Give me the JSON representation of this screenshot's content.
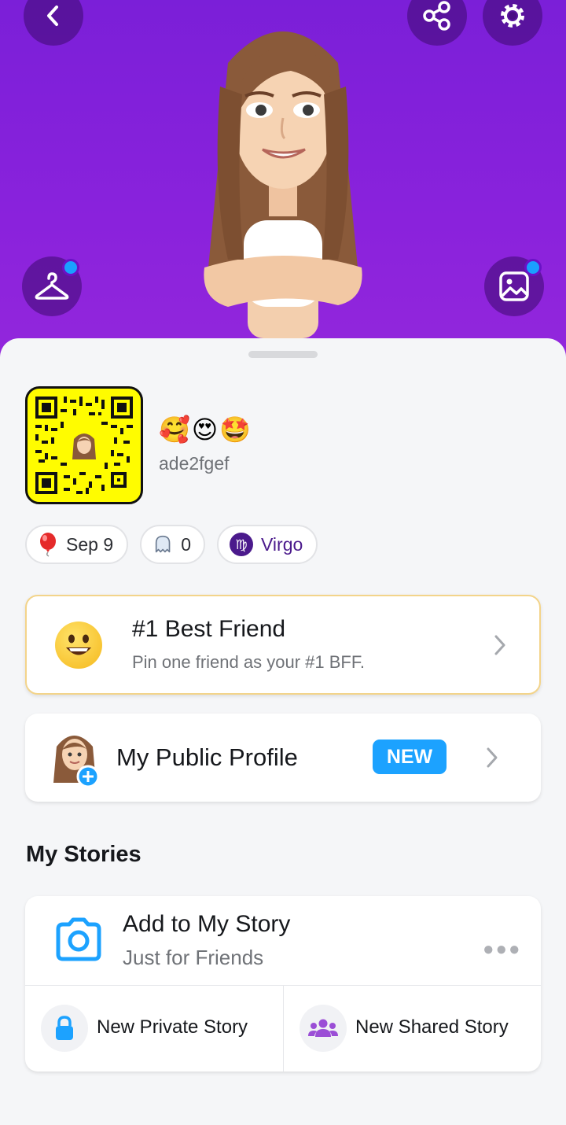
{
  "header": {
    "back_icon": "chevron-left-icon",
    "share_icon": "share-icon",
    "settings_icon": "gear-icon",
    "outfit_icon": "hanger-icon",
    "selfie_icon": "photo-sticker-icon",
    "accent_color": "#8a22dc",
    "notification_dot_color": "#1aa0ff"
  },
  "profile": {
    "emojis": "🥰😍🤩",
    "username": "ade2fgef",
    "snapcode_color": "#fffc00"
  },
  "chips": {
    "birthday": "Sep 9",
    "snapscore": "0",
    "zodiac": "Virgo",
    "birthday_icon": "balloon-icon",
    "snapscore_icon": "ghost-icon",
    "zodiac_icon": "virgo-icon"
  },
  "best_friend": {
    "title": "#1 Best Friend",
    "subtitle": "Pin one friend as your #1 BFF.",
    "icon": "smiley-emoji-icon"
  },
  "public_profile": {
    "title": "My Public Profile",
    "badge": "NEW",
    "badge_color": "#1ca2ff"
  },
  "my_stories": {
    "section_title": "My Stories",
    "add_title": "Add to My Story",
    "add_subtitle": "Just for Friends",
    "private_label": "New Private Story",
    "shared_label": "New Shared Story"
  }
}
